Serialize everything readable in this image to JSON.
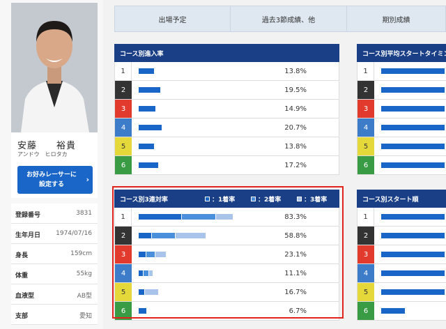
{
  "colors": {
    "header_bg": "#1a3f86",
    "bar_first": "#1a66c8",
    "bar_second": "#4a8fdc",
    "bar_third": "#a8c4ea",
    "highlight": "#e0231c",
    "button": "#1a66c8"
  },
  "course_colors": [
    "#ffffff",
    "#333333",
    "#e23b2e",
    "#3d7cc9",
    "#e5d83a",
    "#3a9b45"
  ],
  "course_text_colors": [
    "#333333",
    "#ffffff",
    "#ffffff",
    "#ffffff",
    "#333333",
    "#ffffff"
  ],
  "profile": {
    "name": "安藤　　裕貴",
    "kana": "アンドウ　ヒロタカ",
    "favorite_button": "お好みレーサーに\n設定する",
    "favorite_icon": "chevron-right-icon",
    "info": [
      {
        "key": "登録番号",
        "value": "3831"
      },
      {
        "key": "生年月日",
        "value": "1974/07/16"
      },
      {
        "key": "身長",
        "value": "159cm"
      },
      {
        "key": "体重",
        "value": "55kg"
      },
      {
        "key": "血液型",
        "value": "AB型"
      },
      {
        "key": "支部",
        "value": "愛知"
      }
    ]
  },
  "tabs": [
    "出場予定",
    "過去3節成績、他",
    "期別成績"
  ],
  "entry_rate": {
    "title": "コース別進入率",
    "rows": [
      {
        "course": "1",
        "value": 13.8,
        "label": "13.8%"
      },
      {
        "course": "2",
        "value": 19.5,
        "label": "19.5%"
      },
      {
        "course": "3",
        "value": 14.9,
        "label": "14.9%"
      },
      {
        "course": "4",
        "value": 20.7,
        "label": "20.7%"
      },
      {
        "course": "5",
        "value": 13.8,
        "label": "13.8%"
      },
      {
        "course": "6",
        "value": 17.2,
        "label": "17.2%"
      }
    ]
  },
  "avg_start": {
    "title": "コース別平均スタートタイミング",
    "rows": [
      {
        "course": "1",
        "fill": 0.97
      },
      {
        "course": "2",
        "fill": 0.97
      },
      {
        "course": "3",
        "fill": 0.97
      },
      {
        "course": "4",
        "fill": 0.97
      },
      {
        "course": "5",
        "fill": 0.97
      },
      {
        "course": "6",
        "fill": 0.97
      }
    ]
  },
  "top3_rate": {
    "title": "コース別3連対率",
    "legend": [
      "：1着率",
      "：2着率",
      "：3着率"
    ],
    "rows": [
      {
        "course": "1",
        "first": 38,
        "second": 30,
        "third": 15.3,
        "label": "83.3%"
      },
      {
        "course": "2",
        "first": 11,
        "second": 21,
        "third": 26.8,
        "label": "58.8%"
      },
      {
        "course": "3",
        "first": 6,
        "second": 8,
        "third": 9.1,
        "label": "23.1%"
      },
      {
        "course": "4",
        "first": 4,
        "second": 4,
        "third": 3.1,
        "label": "11.1%"
      },
      {
        "course": "5",
        "first": 5,
        "second": 0,
        "third": 11.7,
        "label": "16.7%"
      },
      {
        "course": "6",
        "first": 6.7,
        "second": 0,
        "third": 0,
        "label": "6.7%"
      }
    ]
  },
  "start_order": {
    "title": "コース別スタート順",
    "rows": [
      {
        "course": "1",
        "fill": 0.97
      },
      {
        "course": "2",
        "fill": 0.97
      },
      {
        "course": "3",
        "fill": 0.97
      },
      {
        "course": "4",
        "fill": 0.97
      },
      {
        "course": "5",
        "fill": 0.97
      },
      {
        "course": "6",
        "fill": 0.36
      }
    ]
  }
}
